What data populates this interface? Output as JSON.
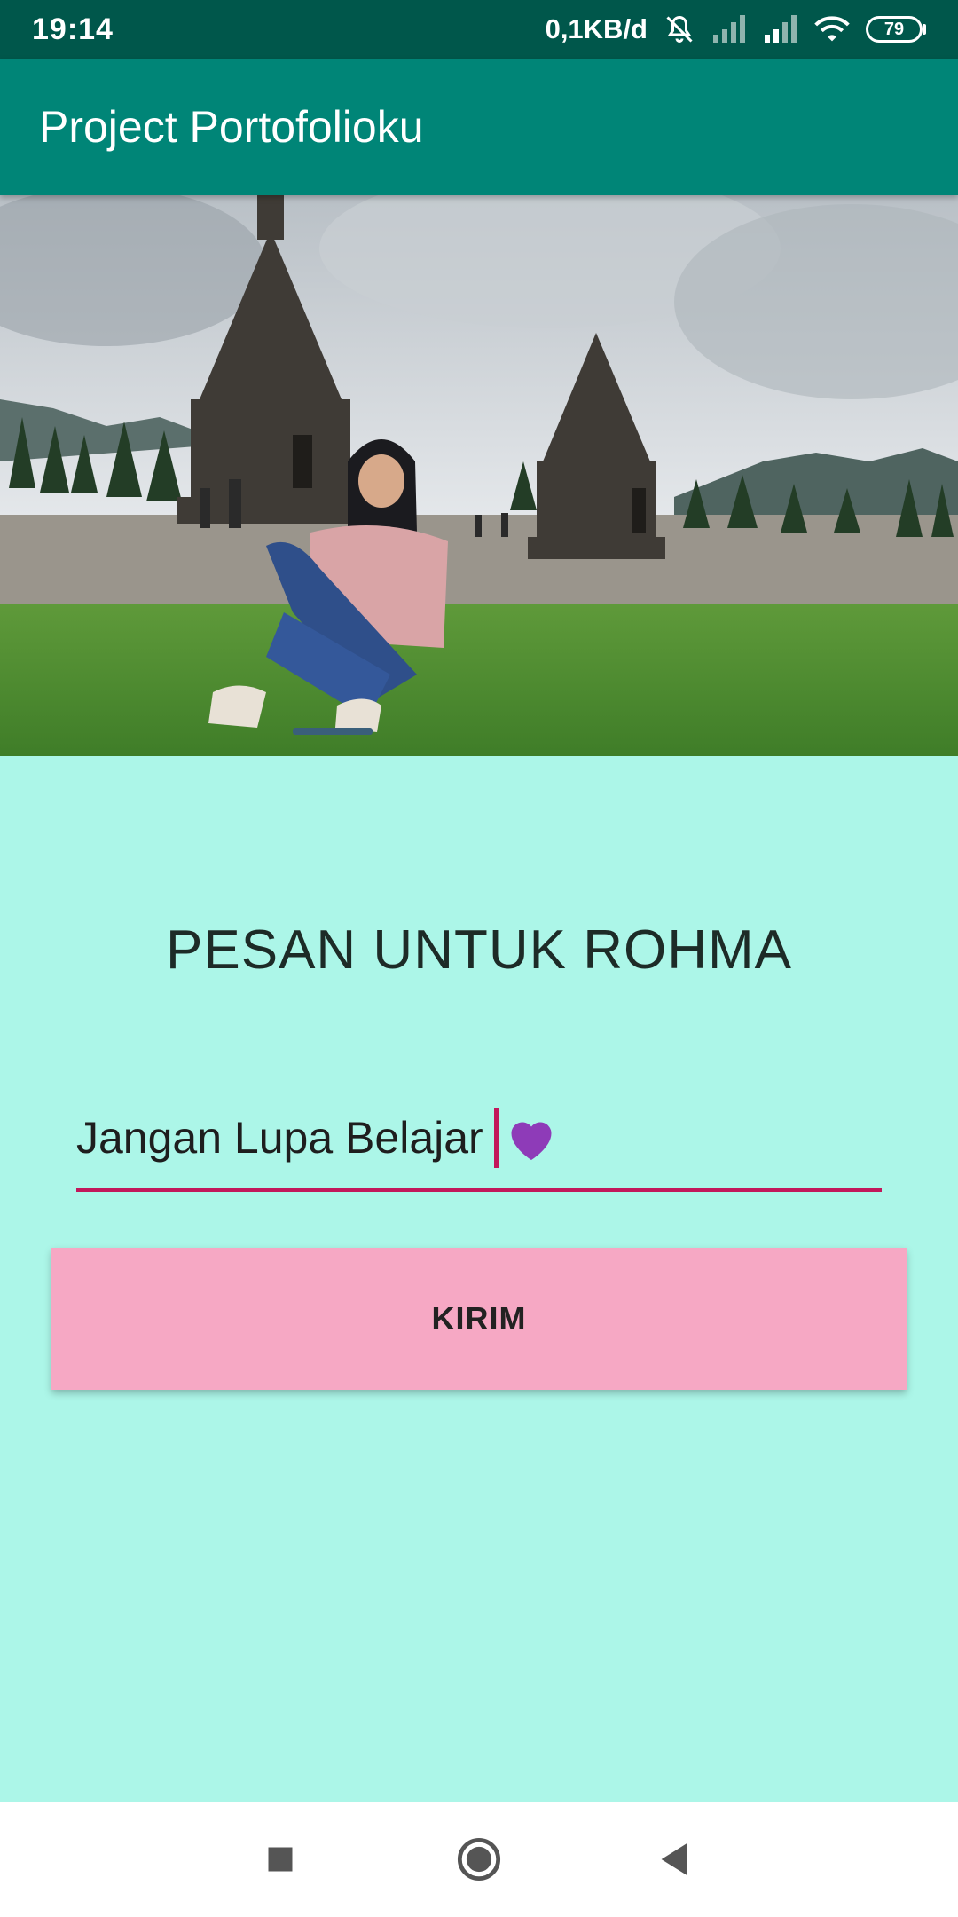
{
  "status_bar": {
    "time": "19:14",
    "net_speed": "0,1KB/d",
    "battery": "79",
    "icons": [
      "mute-icon",
      "signal-empty-icon",
      "signal-icon",
      "wifi-icon",
      "battery-icon"
    ]
  },
  "app_bar": {
    "title": "Project Portofolioku"
  },
  "hero": {
    "description_icon": "photo"
  },
  "main": {
    "title": "PESAN UNTUK ROHMA",
    "message_value": "Jangan Lupa Belajar",
    "send_label": "KIRIM"
  },
  "colors": {
    "status_bar": "#00574b",
    "app_bar": "#008577",
    "background": "#acf6e8",
    "accent": "#c2185b",
    "button": "#f6a8c4"
  },
  "nav_bar": {
    "icons": [
      "recents-icon",
      "home-icon",
      "back-icon"
    ]
  }
}
